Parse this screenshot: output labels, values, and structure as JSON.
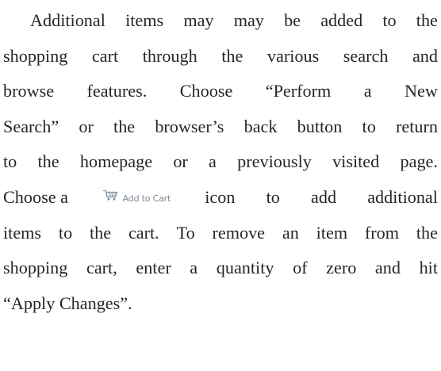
{
  "lines": [
    [
      "Additional",
      "items",
      "may",
      "may",
      "be",
      "added",
      "to",
      "the"
    ],
    [
      "shopping",
      "cart",
      "through",
      "the",
      "various",
      "search",
      "and"
    ],
    [
      "browse",
      "features.",
      "Choose",
      "“Perform",
      "a",
      "New"
    ],
    [
      "Search”",
      "or",
      "the",
      "browser’s",
      "back",
      "button",
      "to",
      "return"
    ],
    [
      "to",
      "the",
      "homepage",
      "or",
      "a",
      "previously",
      "visited",
      "page."
    ],
    {
      "before": "Choose a",
      "icon": "shopping-cart-icon",
      "icon_label": "Add to Cart",
      "after": [
        "icon",
        "to",
        "add",
        "additional"
      ]
    },
    [
      "items",
      "to",
      "the",
      "cart.",
      "To",
      "remove",
      "an",
      "item",
      "from",
      "the"
    ],
    [
      "shopping",
      "cart,",
      "enter",
      "a",
      "quantity",
      "of",
      "zero",
      "and",
      "hit"
    ],
    "“Apply Changes”."
  ],
  "colors": {
    "text": "#262626",
    "icon": "#7d8a96"
  }
}
